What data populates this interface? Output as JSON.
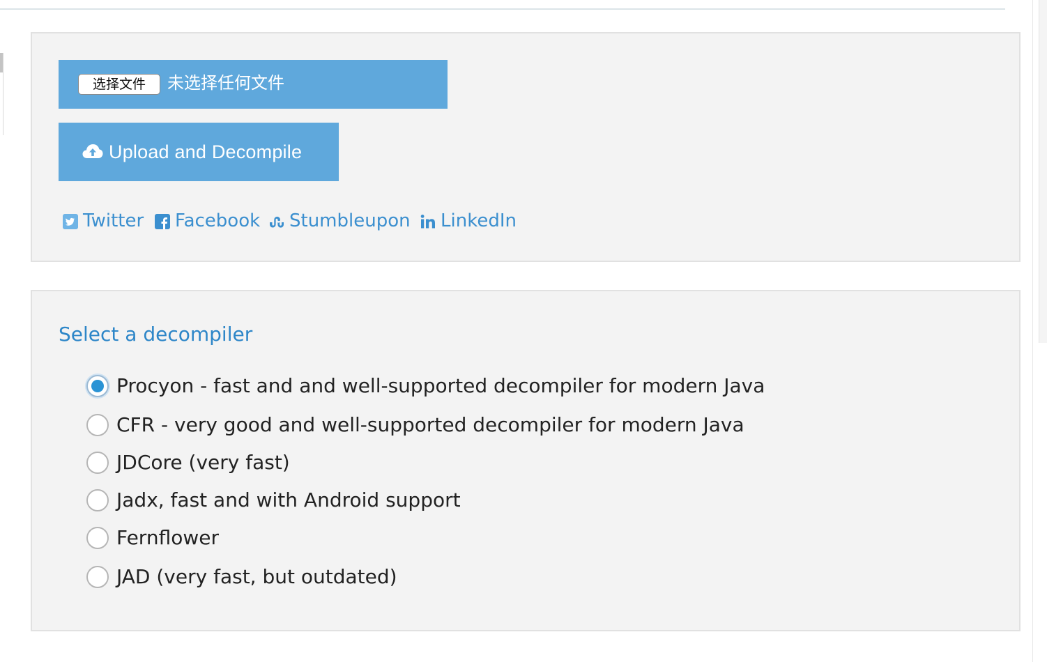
{
  "upload": {
    "choose_file_label": "选择文件",
    "file_status": "未选择任何文件",
    "upload_button_label": "Upload and Decompile"
  },
  "share": {
    "links": [
      {
        "label": "Twitter",
        "icon": "twitter-icon"
      },
      {
        "label": "Facebook",
        "icon": "facebook-icon"
      },
      {
        "label": "Stumbleupon",
        "icon": "stumbleupon-icon"
      },
      {
        "label": "LinkedIn",
        "icon": "linkedin-icon"
      }
    ]
  },
  "decompiler": {
    "title": "Select a decompiler",
    "options": [
      {
        "label": "Procyon - fast and and well-supported decompiler for modern Java",
        "selected": true
      },
      {
        "label": "CFR - very good and well-supported decompiler for modern Java",
        "selected": false
      },
      {
        "label": "JDCore (very fast)",
        "selected": false
      },
      {
        "label": "Jadx, fast and with Android support",
        "selected": false
      },
      {
        "label": "Fernflower",
        "selected": false
      },
      {
        "label": "JAD (very fast, but outdated)",
        "selected": false
      }
    ]
  },
  "colors": {
    "accent": "#5fa8dc",
    "link": "#3b8fcf",
    "title": "#2d86c8",
    "radio_selected": "#2a93d5",
    "panel_bg": "#f3f3f3"
  }
}
